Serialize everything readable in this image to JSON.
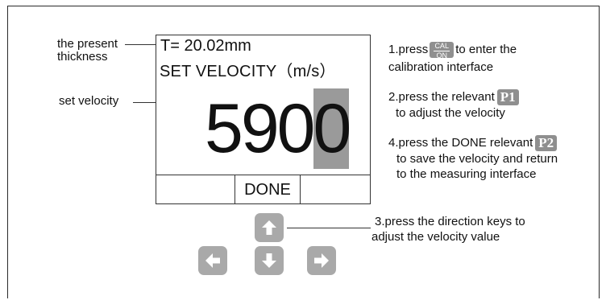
{
  "callouts": {
    "present_thickness": [
      "the present",
      "thickness"
    ],
    "set_velocity": "set velocity"
  },
  "screen": {
    "thickness_line": "T= 20.02mm",
    "velocity_title": "SET VELOCITY（m/s）",
    "velocity_value_prefix": "590",
    "velocity_value_selected": "0",
    "softkey_done": "DONE"
  },
  "keys": {
    "up": "up-arrow-icon",
    "left": "left-arrow-icon",
    "down": "down-arrow-icon",
    "right": "right-arrow-icon"
  },
  "steps": {
    "step1": {
      "pre": "1.press",
      "cal_top": "CAL",
      "cal_bottom": "ON",
      "post": "to enter the",
      "line2": "calibration interface"
    },
    "step2": {
      "line1": "2.press the relevant",
      "badge": "P1",
      "line2": "to adjust the velocity"
    },
    "step4": {
      "line1": "4.press the DONE relevant",
      "badge": "P2",
      "line2": "to save the velocity and return",
      "line3": "to the measuring interface"
    },
    "step3": {
      "line1": "3.press the direction keys to",
      "line2": "adjust the velocity value"
    }
  },
  "colors": {
    "key_gray": "#a9a9a9",
    "badge_gray": "#8f8f8f",
    "selected_digit_bg": "#9a9a9a"
  }
}
